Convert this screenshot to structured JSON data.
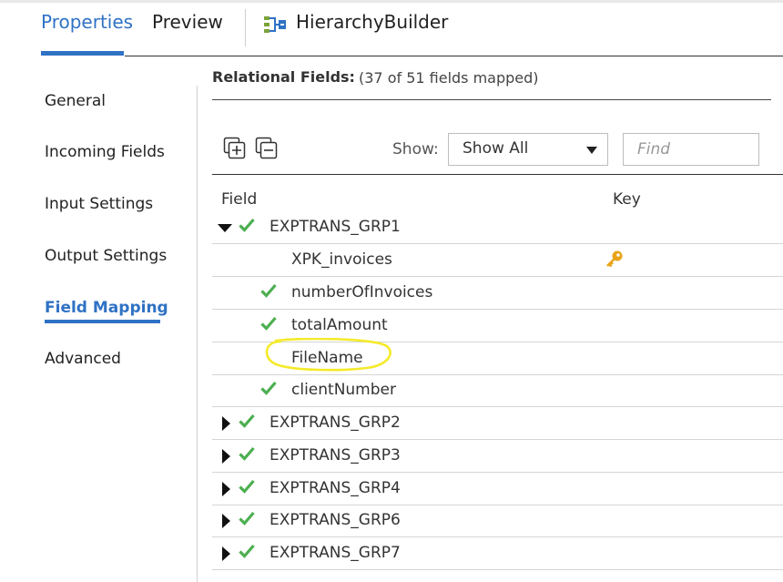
{
  "header": {
    "tabs": [
      {
        "label": "Properties",
        "active": true
      },
      {
        "label": "Preview",
        "active": false
      }
    ],
    "app_title": "HierarchyBuilder",
    "accent_color": "#2f72c4"
  },
  "sidenav": {
    "items": [
      {
        "label": "General",
        "active": false
      },
      {
        "label": "Incoming Fields",
        "active": false
      },
      {
        "label": "Input Settings",
        "active": false
      },
      {
        "label": "Output Settings",
        "active": false
      },
      {
        "label": "Field Mapping",
        "active": true
      },
      {
        "label": "Advanced",
        "active": false
      }
    ]
  },
  "relational": {
    "label": "Relational Fields:",
    "count_text": "(37 of 51 fields mapped)"
  },
  "toolbar": {
    "expand_all_icon": "expand-all-icon",
    "collapse_all_icon": "collapse-all-icon",
    "show_label": "Show:",
    "show_value": "Show All",
    "find_placeholder": "Find"
  },
  "table": {
    "columns": [
      "Field",
      "Key"
    ],
    "rows": [
      {
        "name": "EXPTRANS_GRP1",
        "level": 0,
        "expanded": true,
        "mapped": true,
        "key": false
      },
      {
        "name": "XPK_invoices",
        "level": 1,
        "mapped": false,
        "key": true
      },
      {
        "name": "numberOfInvoices",
        "level": 1,
        "mapped": true,
        "key": false
      },
      {
        "name": "totalAmount",
        "level": 1,
        "mapped": true,
        "key": false
      },
      {
        "name": "FileName",
        "level": 1,
        "mapped": false,
        "key": false,
        "highlighted": true
      },
      {
        "name": "clientNumber",
        "level": 1,
        "mapped": true,
        "key": false
      },
      {
        "name": "EXPTRANS_GRP2",
        "level": 0,
        "expanded": false,
        "mapped": true,
        "key": false
      },
      {
        "name": "EXPTRANS_GRP3",
        "level": 0,
        "expanded": false,
        "mapped": true,
        "key": false
      },
      {
        "name": "EXPTRANS_GRP4",
        "level": 0,
        "expanded": false,
        "mapped": true,
        "key": false
      },
      {
        "name": "EXPTRANS_GRP6",
        "level": 0,
        "expanded": false,
        "mapped": true,
        "key": false
      },
      {
        "name": "EXPTRANS_GRP7",
        "level": 0,
        "expanded": false,
        "mapped": true,
        "key": false
      }
    ]
  },
  "colors": {
    "check": "#4caf50",
    "key": "#e8a317",
    "highlight": "#f5ea2a"
  }
}
